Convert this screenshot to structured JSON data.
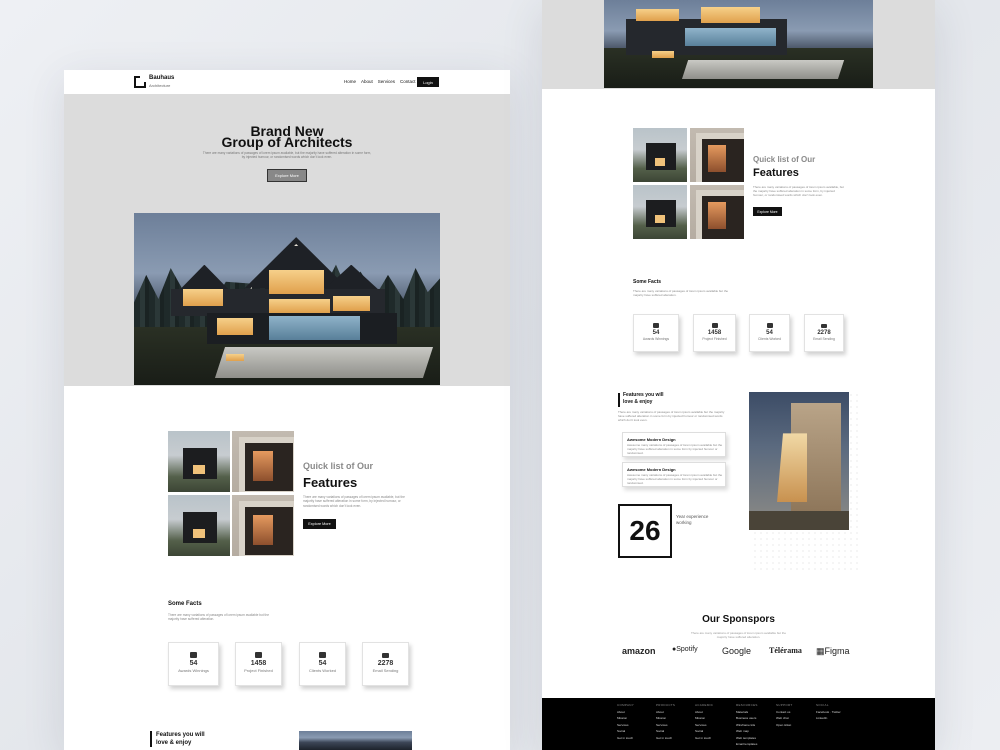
{
  "colors": {
    "background": "#e7e9ed",
    "hero_gray": "#dcdcdc",
    "accent_dark": "#111111",
    "footer": "#000000"
  },
  "brand": {
    "name": "Bauhaus",
    "tagline": "Architecture"
  },
  "nav": {
    "links": [
      "Home",
      "About",
      "Services",
      "Contact"
    ],
    "login_label": "Login"
  },
  "hero": {
    "title_line1": "Brand New",
    "title_line2": "Group of Architects",
    "subtitle": "There are many variations of passages of lorem ipsum available, but the majority have suffered alteration in some form, by injected humour, or randomised words which don't look even.",
    "button_label": "Explore More"
  },
  "features": {
    "kicker": "Quick list of Our",
    "title": "Features",
    "description": "There are many variations of passages of lorem ipsum available, but the majority have suffered alteration in some form, by injected humour, or randomised words which don't look even.",
    "button_label": "Explore More"
  },
  "facts": {
    "title": "Some Facts",
    "description": "There are many variations of passages of lorem ipsum available but the majority have suffered alteration.",
    "stats": [
      {
        "value": "54",
        "label": "Awards Winnings",
        "icon": "gift-icon"
      },
      {
        "value": "1458",
        "label": "Project Finished",
        "icon": "gift-icon"
      },
      {
        "value": "54",
        "label": "Clients Worked",
        "icon": "gift-icon"
      },
      {
        "value": "2278",
        "label": "Email Sending",
        "icon": "envelope-icon"
      }
    ]
  },
  "love": {
    "title_line1": "Features you will",
    "title_line2": "love & enjoy",
    "description": "There are many variations of passages of lorem ipsum available but the majority have suffered alteration in some form by injected humour or randomised words which don't look even.",
    "cards": [
      {
        "title": "Awesome Modern Design",
        "description": "Awesome many variations of passages of lorem ipsum available but the majority have suffered alteration in some form by injected humour or randomised."
      },
      {
        "title": "Awesome Modern Design",
        "description": "Awesome many variations of passages of lorem ipsum available but the majority have suffered alteration in some form by injected humour or randomised."
      }
    ],
    "years_value": "26",
    "years_label": "Year experience working"
  },
  "sponsors": {
    "title": "Our Sponspors",
    "description": "There are many variations of passages of lorem ipsum available but the majority have suffered alteration.",
    "logos": [
      "amazon",
      "Spotify",
      "Google",
      "Télérama",
      "Figma"
    ]
  },
  "footer": {
    "columns": [
      {
        "heading": "COMPANY",
        "items": [
          "About",
          "Mission",
          "Services",
          "Social",
          "Get in touch"
        ]
      },
      {
        "heading": "PRODUCTS",
        "items": [
          "About",
          "Mission",
          "Services",
          "Social",
          "Get in touch"
        ]
      },
      {
        "heading": "ACADEMIC",
        "items": [
          "About",
          "Mission",
          "Services",
          "Social",
          "Get in touch"
        ]
      },
      {
        "heading": "RESOURCES",
        "items": [
          "Materials",
          "Business users",
          "Wireframe kits",
          "Web map",
          "Web templates",
          "Email templates"
        ]
      },
      {
        "heading": "SUPPORT",
        "items": [
          "Contact us",
          "Web chat",
          "Open ticket"
        ]
      },
      {
        "heading": "SOCIAL",
        "items": [
          "Facebook · Twitter",
          "LinkedIn"
        ]
      }
    ]
  }
}
